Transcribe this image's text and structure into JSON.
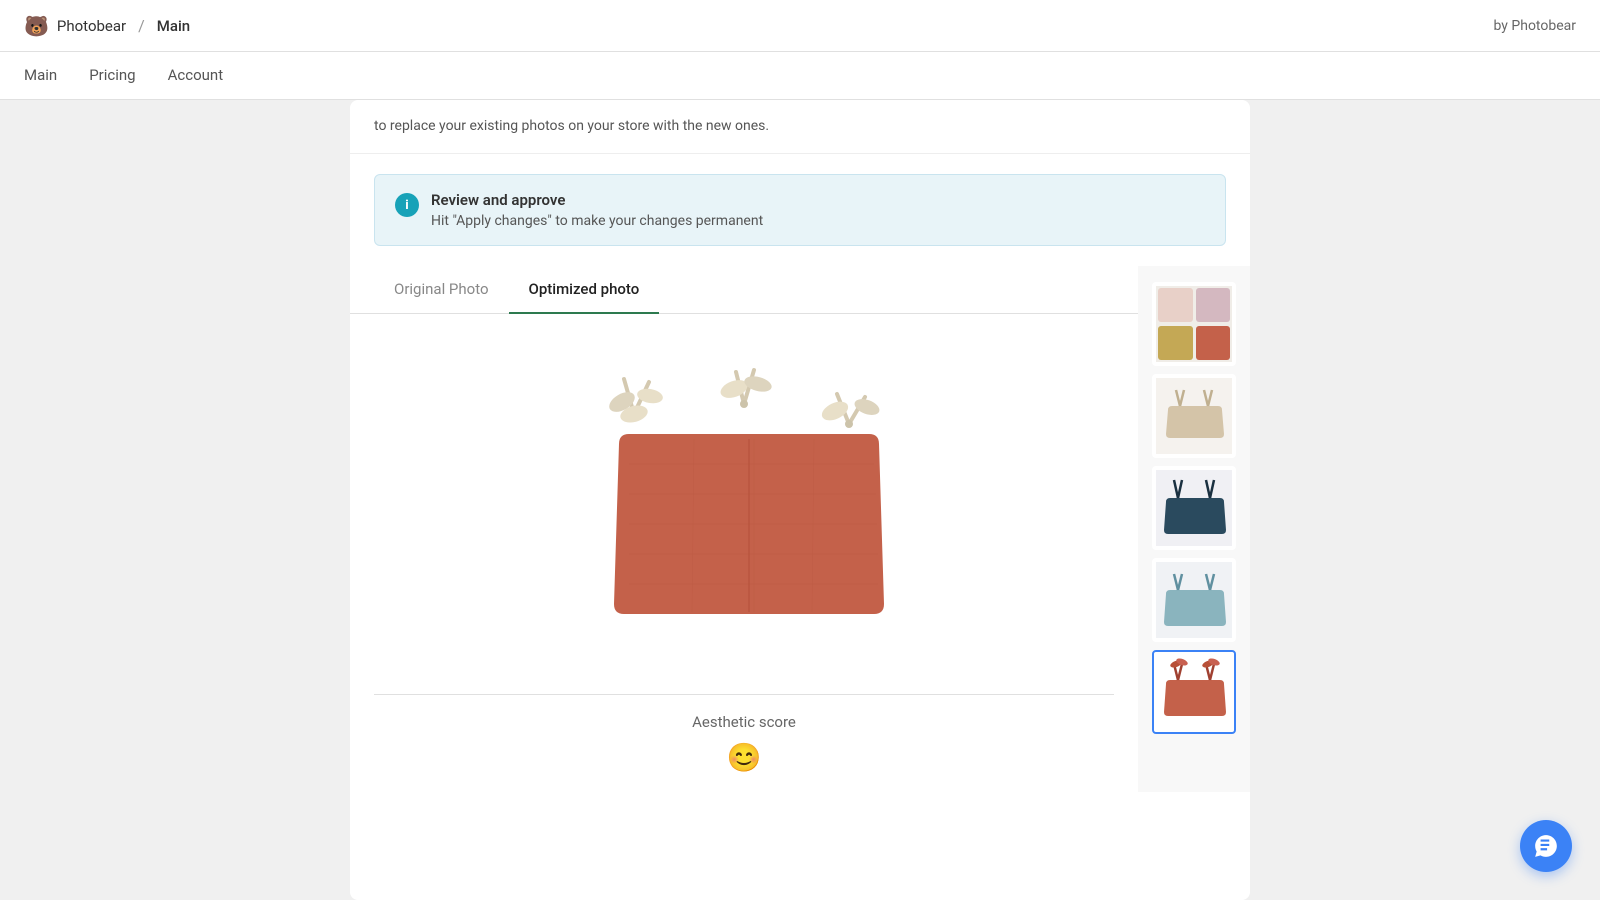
{
  "app": {
    "logo_icon": "🐻",
    "brand": "Photobear",
    "separator": "/",
    "page": "Main",
    "by_label": "by Photobear"
  },
  "nav": {
    "items": [
      {
        "label": "Main",
        "active": false
      },
      {
        "label": "Pricing",
        "active": false
      },
      {
        "label": "Account",
        "active": false
      }
    ]
  },
  "top_text": "to replace your existing photos on your store with the new ones.",
  "banner": {
    "title": "Review and approve",
    "subtitle": "Hit \"Apply changes\" to make your changes permanent"
  },
  "tabs": [
    {
      "label": "Original Photo",
      "active": false
    },
    {
      "label": "Optimized photo",
      "active": true
    }
  ],
  "score": {
    "label": "Aesthetic score",
    "emoji": "😊"
  },
  "chat_button_label": "Chat"
}
